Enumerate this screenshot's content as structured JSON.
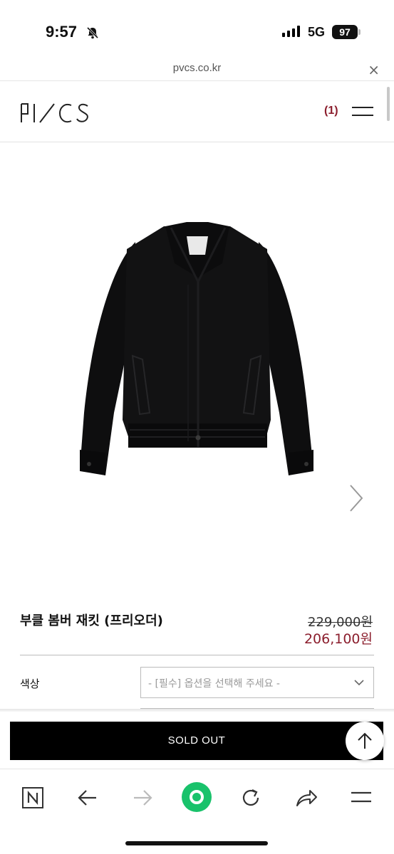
{
  "status_bar": {
    "time": "9:57",
    "network": "5G",
    "battery": "97"
  },
  "browser": {
    "url": "pvcs.co.kr",
    "close_label": "×"
  },
  "header": {
    "logo_text": "PVCS",
    "cart_count": "(1)"
  },
  "product": {
    "name": "부클 봄버 재킷 (프리오더)",
    "price_original": "229,000원",
    "price_sale": "206,100원",
    "option_label": "색상",
    "option_placeholder": "- [필수] 옵션을 선택해 주세요 -",
    "sold_out_label": "SOLD OUT"
  },
  "colors": {
    "accent": "#8b1e2d",
    "button_bg": "#000000",
    "toolbar_green": "#19c26b"
  },
  "icons": {
    "bell": "bell-slash-icon",
    "next": "chevron-right-icon",
    "scroll_top": "arrow-up-icon",
    "toolbar": [
      "naver-n-icon",
      "back-arrow-icon",
      "forward-arrow-icon",
      "green-dot-icon",
      "reload-icon",
      "share-icon",
      "menu-icon"
    ]
  }
}
